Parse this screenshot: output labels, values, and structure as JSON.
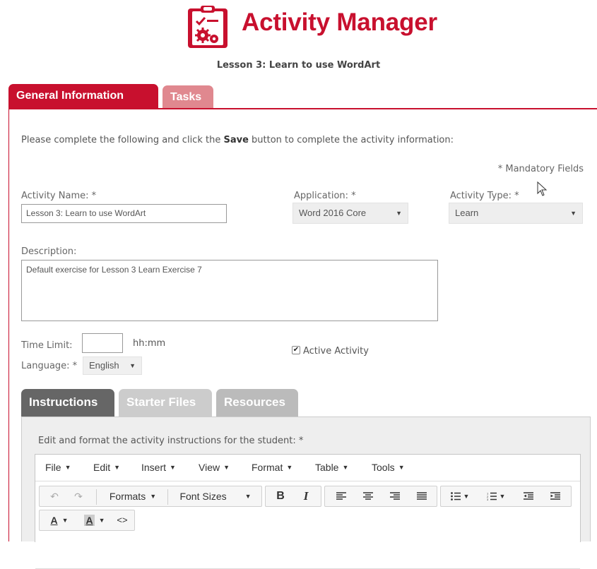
{
  "header": {
    "app_title": "Activity Manager",
    "lesson_title": "Lesson 3: Learn to use WordArt",
    "brand_color": "#c8102e",
    "logo_icon": "clipboard-gears-icon"
  },
  "tabs": [
    {
      "label": "General Information",
      "active": true
    },
    {
      "label": "Tasks",
      "active": false
    }
  ],
  "form": {
    "intro_before": "Please complete the following and click the ",
    "intro_bold": "Save",
    "intro_after": " button to complete the activity information:",
    "mandatory_note": "* Mandatory Fields",
    "activity_name_label": "Activity Name: *",
    "activity_name_value": "Lesson 3: Learn to use WordArt",
    "application_label": "Application: *",
    "application_value": "Word 2016 Core",
    "activity_type_label": "Activity Type: *",
    "activity_type_value": "Learn",
    "description_label": "Description:",
    "description_value": "Default exercise for Lesson 3 Learn Exercise 7",
    "time_limit_label": "Time Limit:",
    "time_limit_value": "",
    "time_format": "hh:mm",
    "language_label": "Language: *",
    "language_value": "English",
    "active_activity_label": "Active Activity",
    "active_activity_checked": true
  },
  "subtabs": [
    {
      "label": "Instructions",
      "active": true
    },
    {
      "label": "Starter Files",
      "active": false
    },
    {
      "label": "Resources",
      "active": false
    }
  ],
  "instructions": {
    "prompt": "Edit and format the activity instructions for the student: *"
  },
  "editor": {
    "menu": [
      "File",
      "Edit",
      "Insert",
      "View",
      "Format",
      "Table",
      "Tools"
    ],
    "formats_label": "Formats",
    "font_sizes_label": "Font Sizes",
    "bold_label": "B",
    "italic_label": "I",
    "text_color_label": "A",
    "bg_color_label": "A",
    "code_label": "<>"
  }
}
